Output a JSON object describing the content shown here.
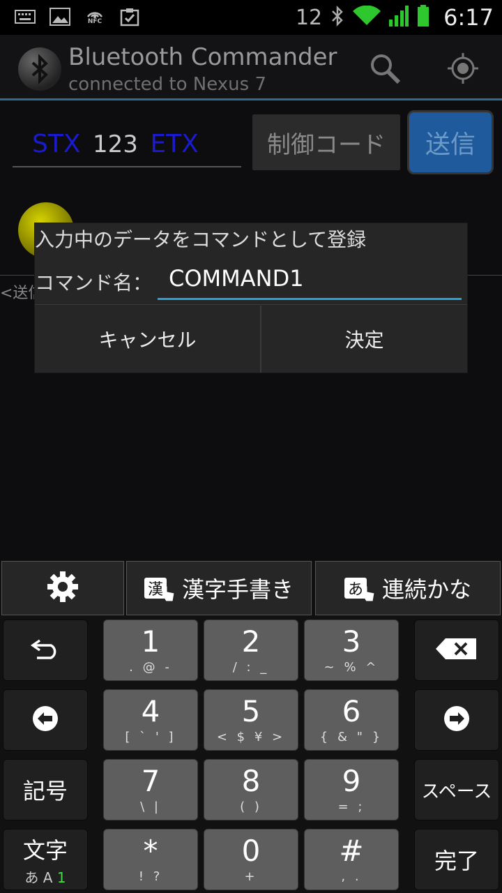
{
  "status_bar": {
    "signal_number": "12",
    "nfc_label": "NFC",
    "time": "6:17",
    "icons": [
      "keyboard-icon",
      "image-icon",
      "nfc-icon",
      "clipboard-check-icon",
      "bluetooth-icon",
      "wifi-icon",
      "signal-icon",
      "battery-icon"
    ]
  },
  "app_bar": {
    "title": "Bluetooth Commander",
    "subtitle": "connected to Nexus 7",
    "icons": [
      "bluetooth-icon",
      "search-icon",
      "locate-icon"
    ]
  },
  "main": {
    "stx": "STX",
    "payload": "123",
    "etx": "ETX",
    "control_code_button": "制御コード",
    "send_button": "送信",
    "send_log_fragment": "<送信"
  },
  "dialog": {
    "title": "入力中のデータをコマンドとして登録",
    "name_label": "コマンド名：",
    "name_value": "COMMAND1",
    "cancel": "キャンセル",
    "ok": "決定"
  },
  "keyboard": {
    "top": {
      "handwriting_glyph": "漢",
      "handwriting_label": "漢字手書き",
      "kana_glyph": "あ",
      "kana_label": "連続かな"
    },
    "keys": {
      "k1": {
        "main": "1",
        "sub": ". @ -"
      },
      "k2": {
        "main": "2",
        "sub": "/ : _"
      },
      "k3": {
        "main": "3",
        "sub": "~ % ^"
      },
      "k4": {
        "main": "4",
        "sub": "[ ` ' ]"
      },
      "k5": {
        "main": "5",
        "sub": "< $ ¥ >"
      },
      "k6": {
        "main": "6",
        "sub": "{ & \" }"
      },
      "k7": {
        "main": "7",
        "sub": "\\ |"
      },
      "k8": {
        "main": "8",
        "sub": "(   )"
      },
      "k9": {
        "main": "9",
        "sub": "= ;"
      },
      "kstar": {
        "main": "*",
        "sub": "! ?"
      },
      "k0": {
        "main": "0",
        "sub": "+"
      },
      "khash": {
        "main": "#",
        "sub": ", ."
      }
    },
    "symbol": "記号",
    "space": "スペース",
    "mode_main": "文字",
    "mode_sub_a": "あ",
    "mode_sub_b": "A",
    "mode_sub_c": "1",
    "done": "完了"
  }
}
